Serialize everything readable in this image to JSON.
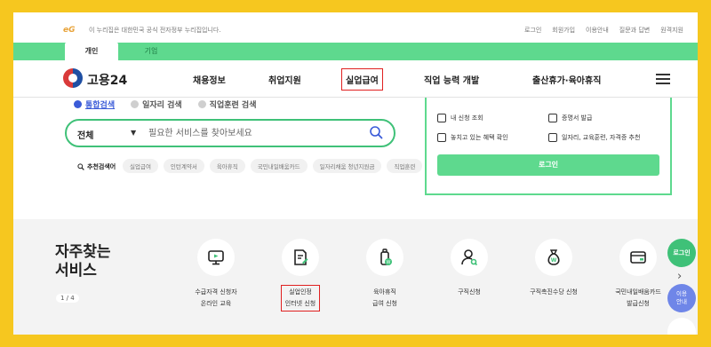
{
  "gov_bar": {
    "logo": "eG",
    "notice": "이 누리집은 대한민국 공식 전자정부 누리집입니다.",
    "util_links": [
      "로그인",
      "회원가입",
      "이용안내",
      "질문과 답변",
      "원격지원"
    ]
  },
  "audience_tabs": [
    "개인",
    "기업"
  ],
  "nav": {
    "logo_text": "고용24",
    "items": [
      "채용정보",
      "취업지원",
      "실업급여",
      "직업 능력 개발",
      "출산휴가·육아휴직"
    ],
    "highlighted": "실업급여"
  },
  "search": {
    "tabs": [
      {
        "label": "통합검색",
        "selected": true
      },
      {
        "label": "일자리 검색",
        "selected": false
      },
      {
        "label": "직업훈련 검색",
        "selected": false
      }
    ],
    "scope": "전체",
    "placeholder": "필요한 서비스를 찾아보세요",
    "recommend_label": "추천검색어",
    "chips": [
      "실업급여",
      "인턴계약서",
      "육아휴직",
      "국민내일배움카드",
      "일자리채움 청년지원금",
      "직업훈련"
    ]
  },
  "login_panel": {
    "items": [
      "내 신청 조회",
      "증명서 발급",
      "놓치고 있는 혜택 확인",
      "일자리, 교육훈련, 자격증 추천"
    ],
    "login_button": "로그인"
  },
  "services": {
    "title": "자주찾는 서비스",
    "page": "1 / 4",
    "items": [
      {
        "label": "수급자격 신청자\n온라인 교육",
        "icon": "monitor-icon",
        "highlight": false
      },
      {
        "label": "실업인정\n인터넷 신청",
        "icon": "document-pen-icon",
        "highlight": true
      },
      {
        "label": "육아휴직\n급여 신청",
        "icon": "baby-bottle-icon",
        "highlight": false
      },
      {
        "label": "구직신청",
        "icon": "user-search-icon",
        "highlight": false
      },
      {
        "label": "구직촉진수당 신청",
        "icon": "money-bag-icon",
        "highlight": false
      },
      {
        "label": "국민내일배움카드\n발급신청",
        "icon": "card-icon",
        "highlight": false
      }
    ]
  },
  "quick_menu": {
    "login": "로그인",
    "next": "›",
    "help": "이용\n안내"
  }
}
